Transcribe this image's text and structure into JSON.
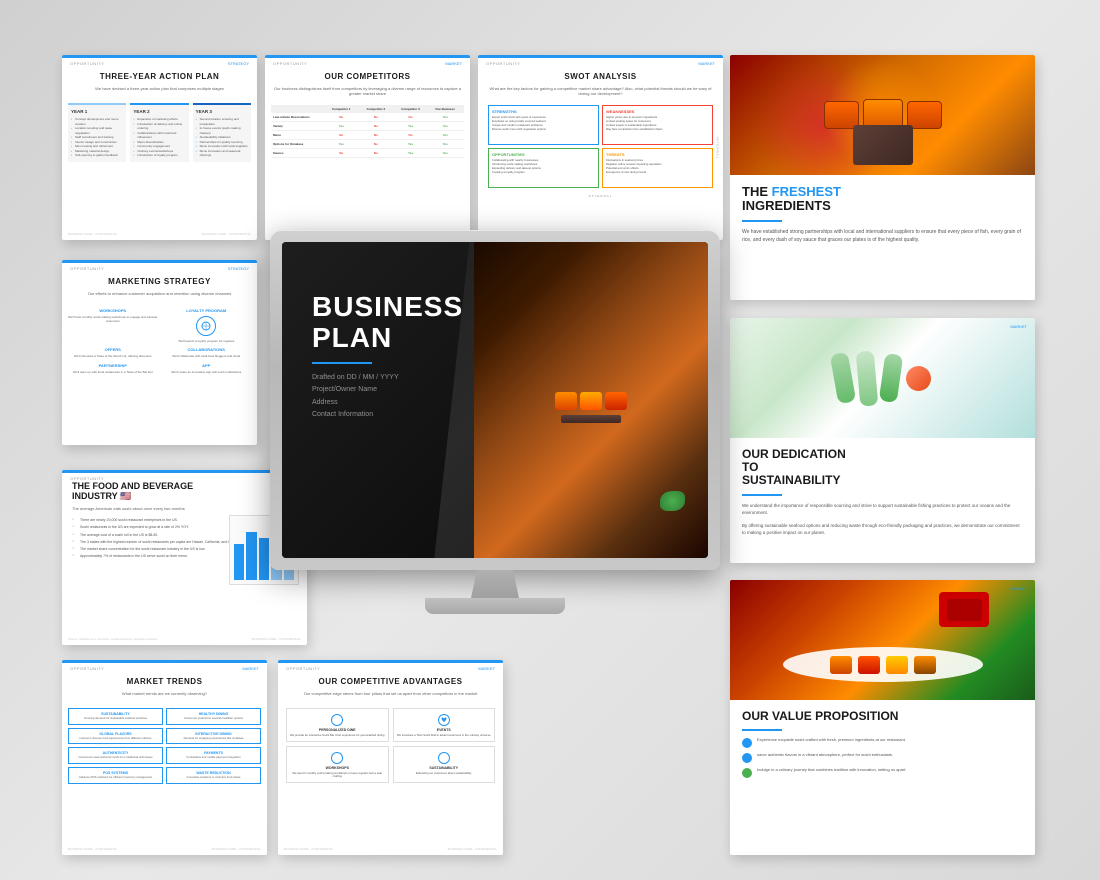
{
  "slides": {
    "three_year": {
      "tag_left": "OPPORTUNITY",
      "tag_right": "STRATEGY",
      "title": "THREE-YEAR ACTION PLAN",
      "subtitle": "We have devised a three-year action plan that comprises multiple stages",
      "years": [
        {
          "label": "YEAR 1",
          "items": [
            "Concept development and menu creation",
            "Location scouting and lease negotiation",
            "Staff recruitment and training initiatives",
            "Interior design and construction commencement",
            "Menu testing and refinement",
            "Marketing material design and branding",
            "Soft-opening to gather feedback"
          ]
        },
        {
          "label": "YEAR 2",
          "items": [
            "Expansion of marketing efforts",
            "Introduction of delivery and online ordering",
            "Collaborations with local food influencers",
            "Menu diversification based on customer feedback",
            "Community engagement and partnerships",
            "Host culinary events/workshops",
            "Introduction of loyalty program"
          ]
        },
        {
          "label": "YEAR 3",
          "items": [
            "Second location scouting and preparation",
            "In-house events (sushi-making classes, themed nights)",
            "Sustainability initiatives",
            "Partnerships for quality sourcing",
            "Menu innovation with local suppliers and farms",
            "Menu innovation and seasonal offerings"
          ]
        }
      ]
    },
    "competitors": {
      "tag_left": "OPPORTUNITY",
      "tag_right": "MARKET",
      "title": "OUR COMPETITORS",
      "subtitle": "Our business distinguishes itself from competitors by leveraging a diverse range of resources to capture a greater market share",
      "headers": [
        "",
        "Competitor 1",
        "Competitor 2",
        "Competitor 3",
        "Our Business"
      ],
      "rows": [
        {
          "label": "Last-minute Reservations",
          "vals": [
            "No",
            "No",
            "No",
            "Yes"
          ]
        },
        {
          "label": "Variety",
          "vals": [
            "Yes",
            "No",
            "Yes",
            "Yes"
          ]
        },
        {
          "label": "Menu",
          "vals": [
            "No",
            "No",
            "No",
            "Yes"
          ]
        },
        {
          "label": "Options for Omakase",
          "vals": [
            "Yes",
            "No",
            "Yes",
            "Yes"
          ]
        },
        {
          "label": "Sauces",
          "vals": [
            "No",
            "No",
            "Yes",
            "Yes"
          ]
        }
      ]
    },
    "swot": {
      "tag_left": "OPPORTUNITY",
      "tag_right": "MARKET",
      "title": "SWOT ANALYSIS",
      "question": "What are the key factors for gaining a competitive market share advantage? Also, what potential threats should we be wary of during our development?",
      "strengths": [
        "Expert sushi chefs with years of experience",
        "Emphasis on using locally sourced seafood",
        "Unique and modern restaurant ambiance",
        "Diverse sushi menu with vegetarian options"
      ],
      "weaknesses": [
        "Higher prices due to premium ingredients",
        "Limited parking space for customers",
        "Limited supply of sustainable ingredients",
        "May face competition from established sushi chains"
      ],
      "opportunities": [
        "Collaborating with nearby businesses for lunch deals",
        "Introducing sushi-making workshops for customers",
        "Expanding delivery and takeout options",
        "Creating a loyalty program to encourage repeat"
      ],
      "threats": [
        "Fluctuations in seafood prices due to supply chain",
        "Negative online reviews impacting reputation",
        "Potential economic effects on discretionary consumption",
        "Emergence of new dining trends diverting customer"
      ]
    },
    "freshest": {
      "tag_right": "MARKET",
      "title": "THE FRESHEST INGREDIENTS",
      "text": "We have established strong partnerships with local and international suppliers to ensure that every piece of fish, every grain of rice, and every dash of soy sauce that graces our plates is of the highest quality."
    },
    "marketing": {
      "tag_left": "OPPORTUNITY",
      "tag_right": "STRATEGY",
      "title": "MARKETING STRATEGY",
      "subtitle": "Our efforts to enhance customer acquisition and retention using diverse channels",
      "items": [
        {
          "title": "WORKSHOPS",
          "text": "We'll host monthly sushi-making workshops to engage and educate customers"
        },
        {
          "title": "LOYALTY PROGRAM",
          "text": "We'll launch a loyalty program shows our appreciation for regulars, incentivizing them to be lifelong customers"
        },
        {
          "title": "OFFERS",
          "text": "We'll introduce a Taste of the Month cut, offering discounts on popular menu items"
        },
        {
          "title": "COLLABORATIONS",
          "text": "We'll collaborate with local food bloggers, chefs and celebrities"
        },
        {
          "title": "PARTNERSHIP",
          "text": "We'll team up with local restaurants in a Taste of the Bai fest, supporting community businesses"
        },
        {
          "title": "APP",
          "text": "We'll create an innovative app that offers push notifications for offers and events"
        }
      ]
    },
    "sustainability": {
      "tag_right": "MARKET",
      "title": "OUR DEDICATION TO SUSTAINABILITY",
      "text1": "We understand the importance of responsible sourcing and strive to support sustainable fishing practices to protect our oceans and the environment.",
      "text2": "By offering sustainable seafood options and reducing waste through eco-friendly packaging and practices, we demonstrate our commitment to making a positive impact on our planet."
    },
    "food_beverage": {
      "tag_left": "OPPORTUNITY",
      "title": "THE FOOD AND BEVERAGE INDUSTRY",
      "subtitle": "The average American eats sushi about once every two months",
      "stats": [
        "There are nearly 20,000 sushi restaurant enterprises in the US.",
        "Sushi restaurants in the US are expected to grow at a rate of 2% YOY.",
        "The average cost of a sushi roll in the US is $8.50.",
        "The 3 states with the highest number of sushi restaurants per capita are Hawaii, California, and New York.",
        "The market share concentration for the sushi restaurant industry in the US is low, which means the top five companies generate less than 40% of industry revenue.",
        "Approximately 7% of restaurants in the US serve sushi on their menu."
      ]
    },
    "market_trends": {
      "tag_left": "OPPORTUNITY",
      "tag_right": "MARKET",
      "title": "MARKET TRENDS",
      "question": "What market trends are we currently observing?",
      "cells": [
        {
          "title": "SUSTAINABILITY",
          "text": "Growing demand for sustainable seafood practices in restaurants"
        },
        {
          "title": "HEALTHY DINING",
          "text": "Consumer preference towards healthier options, making sushi an appealing choice"
        },
        {
          "title": "GLOBAL FLAVORS",
          "text": "Increased interest in diverse food experiences from different cultures"
        },
        {
          "title": "INTERACTIVE DINING",
          "text": "Demand for engaging experiences like chef's table or omakase at the table"
        },
        {
          "title": "AUTHENTICITY",
          "text": "Consumers seek authentic sushi experiences from traditional techniques and ingredients"
        },
        {
          "title": "PAYMENTS",
          "text": "Contactless and mobile payment integration becoming standard practice"
        },
        {
          "title": "POS SYSTEMS",
          "text": "Advance POS solutions for efficient and accurate inventory management"
        },
        {
          "title": "WASTE REDUCTION",
          "text": "Innovative solutions to minimize food waste and composting"
        }
      ]
    },
    "competitive_adv": {
      "tag_left": "OPPORTUNITY",
      "tag_right": "MARKET",
      "title": "OUR COMPETITIVE ADVANTAGES",
      "subtitle": "Our competitive edge stems from four pillars that set us apart from other competitors in the market",
      "items": [
        {
          "title": "PERSONALIZED DINE",
          "text": "We provide an interactive Sushi Bar Chef Sushi Roll experience for personalized dining"
        },
        {
          "title": "EVENTS",
          "text": "We introduce a Totto Sushi Roll to attract customers far and wide in the culinary universe"
        },
        {
          "title": "WORKSHOPS",
          "text": "We launch monthly sushi-making workshops to keep regulars that feel a safe crafting"
        },
        {
          "title": "SUSTAINABILITY",
          "text": "Pledge Impacting our business by educating our customers about sustainability"
        }
      ]
    },
    "value_prop": {
      "tag_right": "MARKET",
      "title": "OUR VALUE PROPOSITION",
      "items": [
        {
          "icon": "blue",
          "text": "Experience exquisite sushi crafted with fresh, premium ingredients at our restaurant."
        },
        {
          "icon": "blue",
          "text": "savor authentic flavors in a vibrant atmosphere, perfect for sushi enthusiasts."
        },
        {
          "icon": "green",
          "text": "Indulge in a culinary journey that combines tradition with innovation, setting us apart."
        }
      ]
    },
    "business_plan": {
      "title": "BUSINESS",
      "title2": "PLAN",
      "drafted": "Drafted on DD / MM / YYYY",
      "project": "Project/Owner Name",
      "address": "Address",
      "contact": "Contact Information"
    }
  }
}
